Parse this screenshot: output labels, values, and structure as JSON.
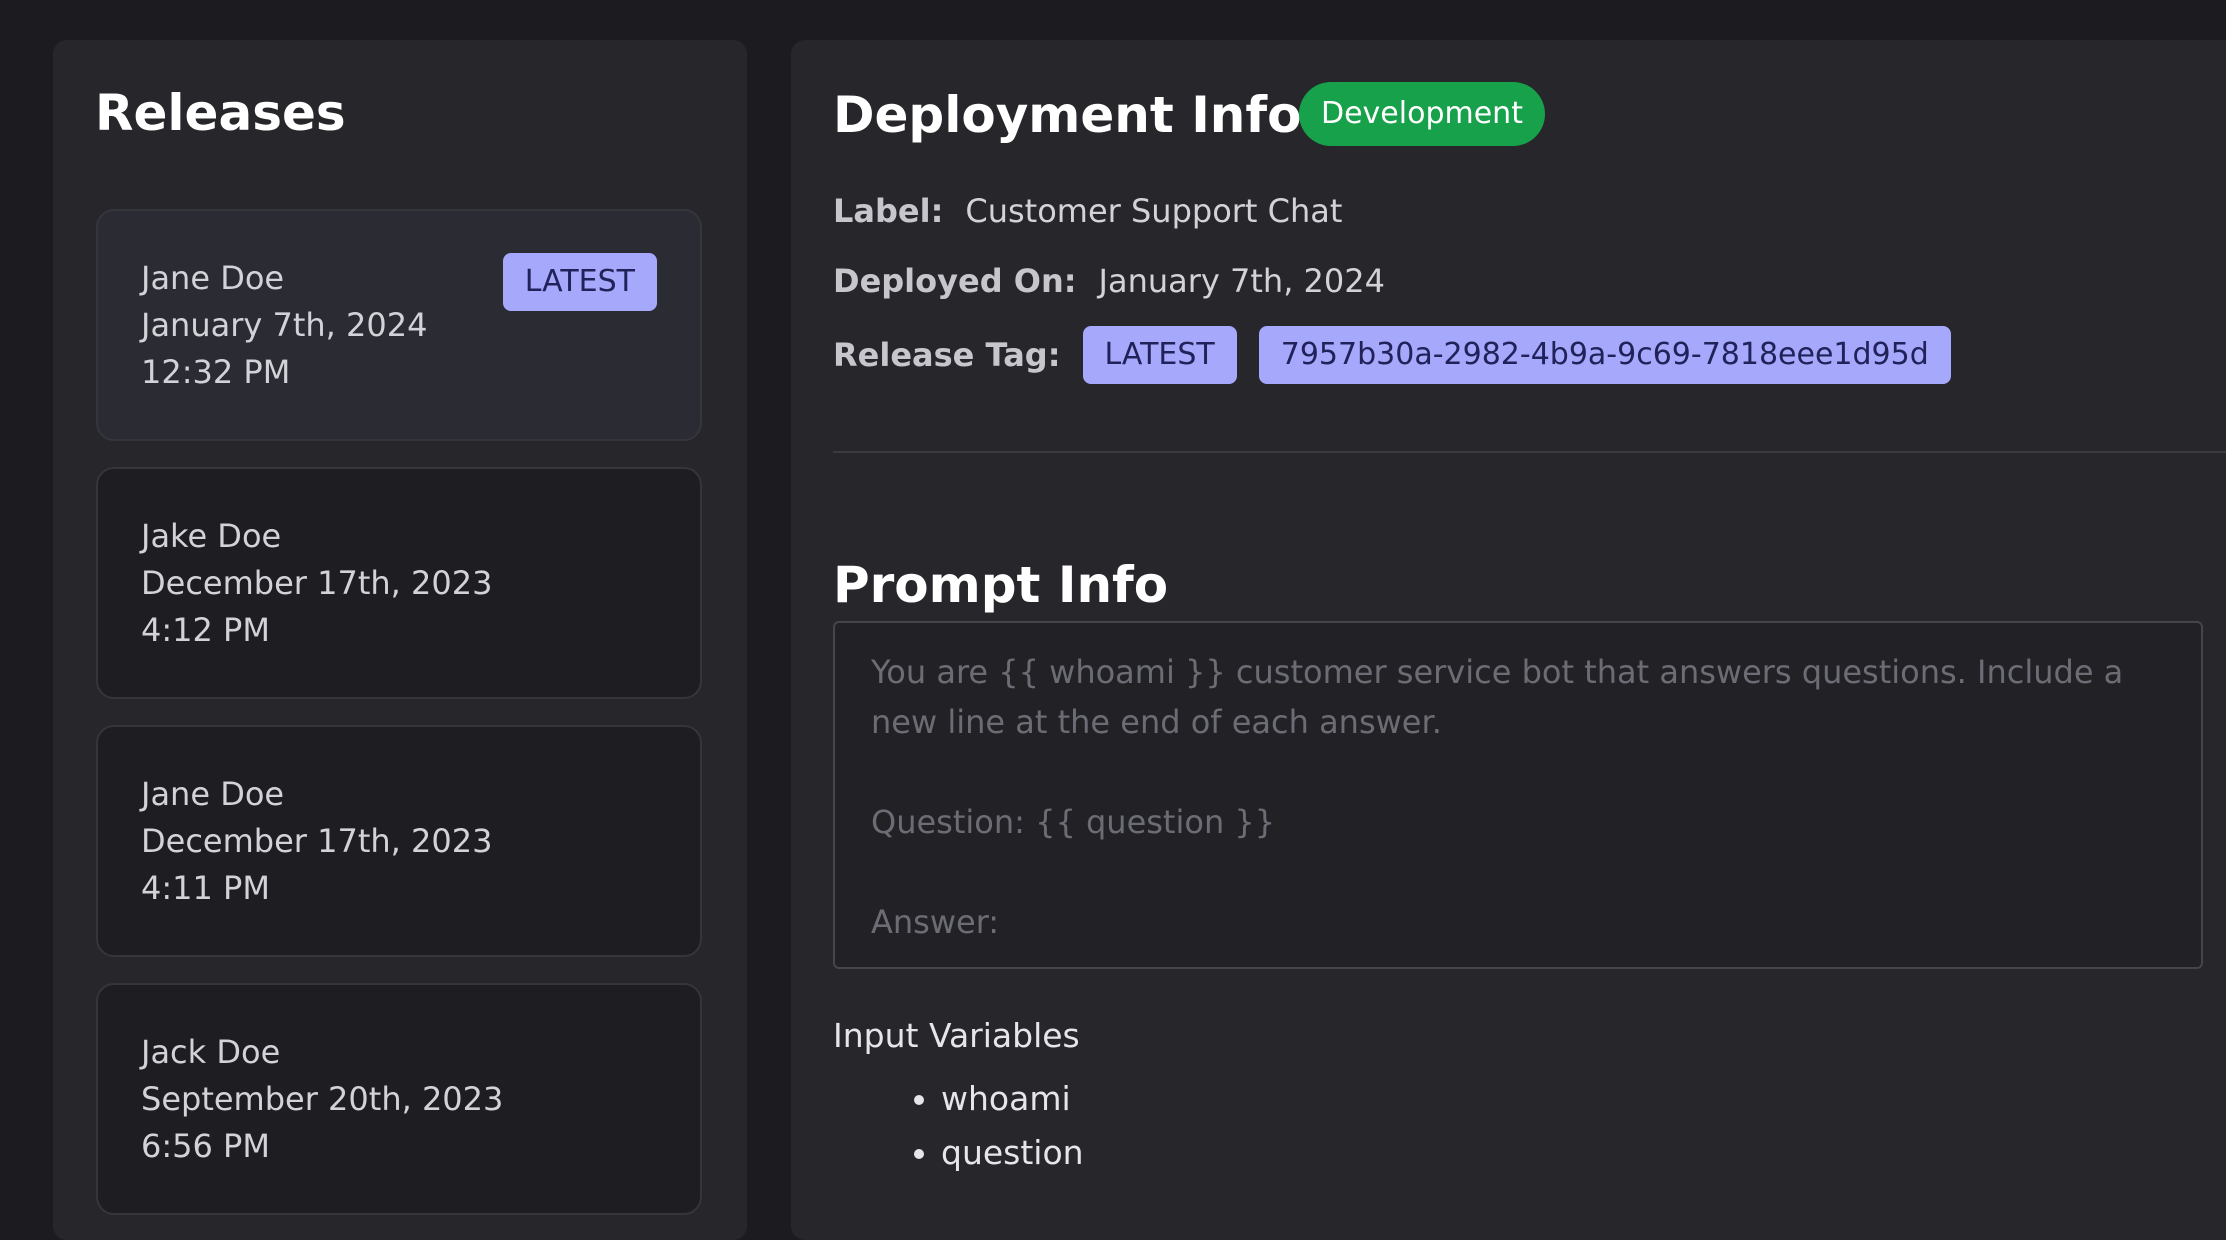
{
  "releases": {
    "title": "Releases",
    "items": [
      {
        "author": "Jane Doe",
        "date": "January 7th, 2024",
        "time": "12:32 PM",
        "tag": "LATEST"
      },
      {
        "author": "Jake Doe",
        "date": "December 17th, 2023",
        "time": "4:12 PM"
      },
      {
        "author": "Jane Doe",
        "date": "December 17th, 2023",
        "time": "4:11 PM"
      },
      {
        "author": "Jack Doe",
        "date": "September 20th, 2023",
        "time": "6:56 PM"
      }
    ]
  },
  "deployment": {
    "title": "Deployment Info",
    "environment": "Development",
    "label_key": "Label:",
    "label_value": "Customer Support Chat",
    "deployed_key": "Deployed On:",
    "deployed_value": "January 7th, 2024",
    "release_tag_key": "Release Tag:",
    "release_tag_latest": "LATEST",
    "release_tag_id": "7957b30a-2982-4b9a-9c69-7818eee1d95d"
  },
  "prompt": {
    "title": "Prompt Info",
    "template": "You are {{ whoami }} customer service bot that answers questions. Include a new line at the end of each answer.\n\nQuestion: {{ question }}\n\nAnswer:",
    "input_variables_title": "Input Variables",
    "input_variables": [
      "whoami",
      "question"
    ]
  },
  "colors": {
    "background": "#1b1b20",
    "panel": "#26262b",
    "tag": "#a5a8fb",
    "environment_badge": "#17a14a"
  }
}
